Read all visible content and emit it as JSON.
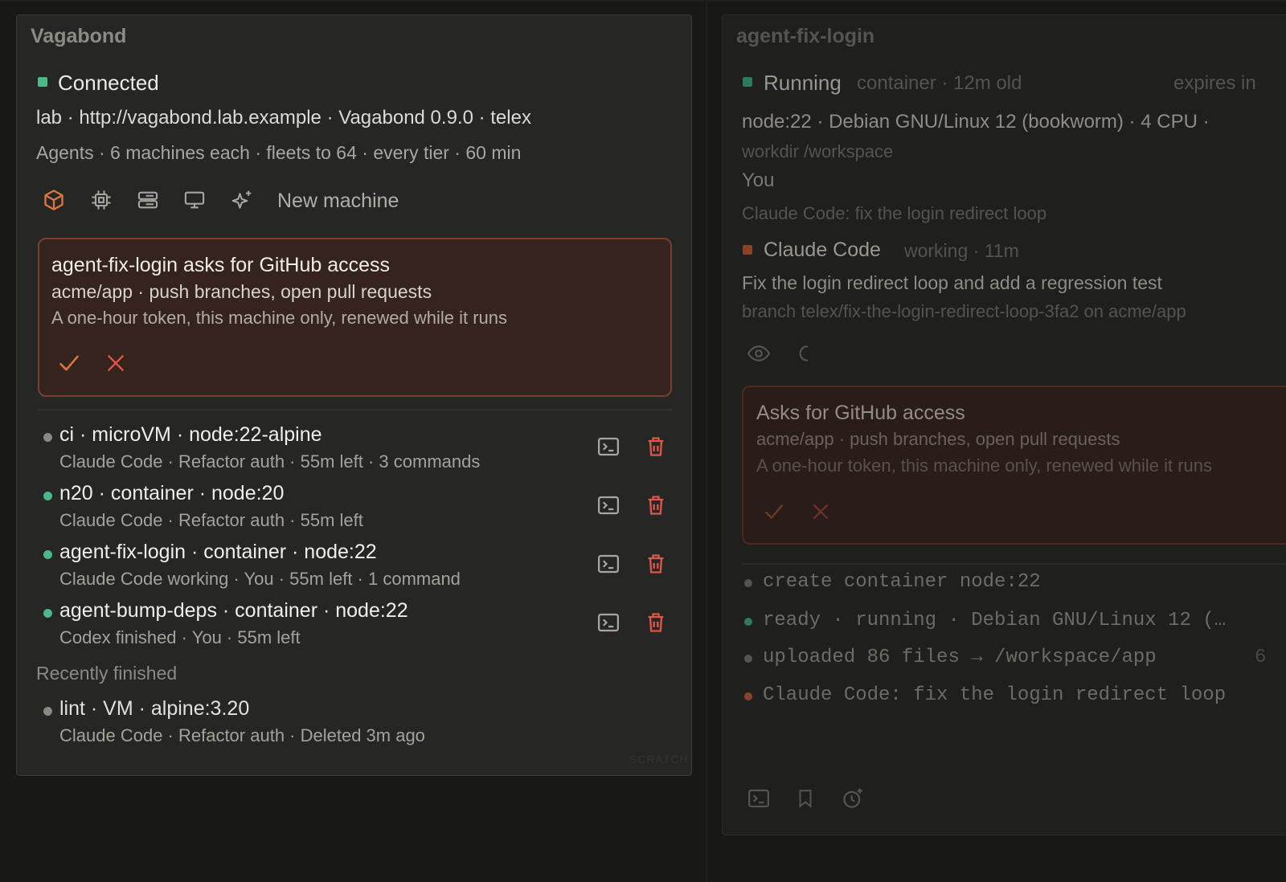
{
  "left": {
    "title": "Vagabond",
    "status": "Connected",
    "server_line": "lab · http://vagabond.lab.example · Vagabond 0.9.0 · telex",
    "limits_line": "Agents · 6 machines each · fleets to 64 · every tier · 60 min",
    "toolbar": {
      "icons": [
        "cube-icon",
        "cpu-chip-icon",
        "server-icon",
        "monitor-icon",
        "sparkle-icon"
      ],
      "new_machine_label": "New machine"
    },
    "approval": {
      "title": "agent-fix-login asks for GitHub access",
      "scope": "acme/app · push branches, open pull requests",
      "detail": "A one-hour token, this machine only, renewed while it runs"
    },
    "machines": [
      {
        "title": "ci · microVM · node:22-alpine",
        "sub": "Claude Code · Refactor auth · 55m left · 3 commands",
        "status": "idle"
      },
      {
        "title": "n20 · container · node:20",
        "sub": "Claude Code · Refactor auth · 55m left",
        "status": "running"
      },
      {
        "title": "agent-fix-login · container · node:22",
        "sub": "Claude Code working · You · 55m left · 1 command",
        "status": "running"
      },
      {
        "title": "agent-bump-deps · container · node:22",
        "sub": "Codex finished · You · 55m left",
        "status": "running"
      }
    ],
    "recent_heading": "Recently finished",
    "recent": [
      {
        "title": "lint · VM · alpine:3.20",
        "sub": "Claude Code · Refactor auth · Deleted 3m ago"
      }
    ],
    "watermark": "SCRATCH"
  },
  "right": {
    "title": "agent-fix-login",
    "status": "Running",
    "status_meta": "container · 12m old",
    "expires": "expires in",
    "image_line": "node:22 · Debian GNU/Linux 12 (bookworm) · 4 CPU ·",
    "workdir": "workdir /workspace",
    "you": "You",
    "task": "Claude Code: fix the login redirect loop",
    "agent_name": "Claude Code",
    "agent_meta": "working · 11m",
    "agent_task": "Fix the login redirect loop and add a regression test",
    "branch": "branch telex/fix-the-login-redirect-loop-3fa2 on acme/app",
    "approval": {
      "title": "Asks for GitHub access",
      "scope": "acme/app · push branches, open pull requests",
      "detail": "A one-hour token, this machine only, renewed while it runs"
    },
    "log": [
      {
        "text": "create container node:22",
        "color": "#8a8880"
      },
      {
        "text": "ready · running · Debian GNU/Linux 12 (…",
        "color": "#3f8f6c"
      },
      {
        "text": "uploaded 86 files → /workspace/app",
        "color": "#8a8880"
      },
      {
        "text": "Claude Code: fix the login redirect loop",
        "color": "#b8603f"
      }
    ],
    "log_right_fragment": "6"
  },
  "colors": {
    "accent_green": "#4bb88a",
    "accent_orange": "#d9773f",
    "danger_red": "#e0554a",
    "approval_bg": "#35231d",
    "approval_border": "#74402f"
  }
}
